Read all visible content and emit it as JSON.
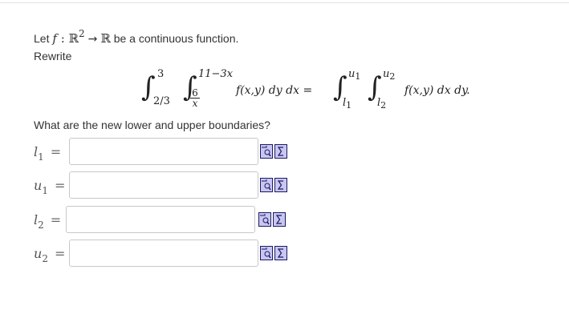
{
  "question": {
    "intro_prefix": "Let ",
    "f": "f",
    "colon": " : ",
    "domain_set": "ℝ",
    "domain_exp": "2",
    "arrow": "→",
    "codomain_set": "ℝ",
    "intro_suffix": " be a continuous function.",
    "rewrite": "Rewrite"
  },
  "equation": {
    "outer_lower": "2/3",
    "outer_upper": "3",
    "inner_lower_num": "6",
    "inner_lower_den": "x",
    "inner_upper": "11−3x",
    "integrand_left": "f(x,y) dy dx =",
    "new_outer_upper": "u",
    "new_outer_upper_sub": "1",
    "new_outer_lower": "l",
    "new_outer_lower_sub": "1",
    "new_inner_upper": "u",
    "new_inner_upper_sub": "2",
    "new_inner_lower": "l",
    "new_inner_lower_sub": "2",
    "integrand_right": "f(x,y) dx dy."
  },
  "subprompt": "What are the new lower and upper boundaries?",
  "answers": [
    {
      "var": "l",
      "sub": "1",
      "eq": "=",
      "value": "",
      "placeholder": ""
    },
    {
      "var": "u",
      "sub": "1",
      "eq": "=",
      "value": "",
      "placeholder": ""
    },
    {
      "var": "l",
      "sub": "2",
      "eq": "=",
      "value": "",
      "placeholder": ""
    },
    {
      "var": "u",
      "sub": "2",
      "eq": "=",
      "value": "",
      "placeholder": ""
    }
  ],
  "icons": {
    "preview": "preview-icon",
    "formula_editor": "formula-editor-icon",
    "frame_color": "#1a1a66",
    "fill_color": "#c9c6f0"
  }
}
